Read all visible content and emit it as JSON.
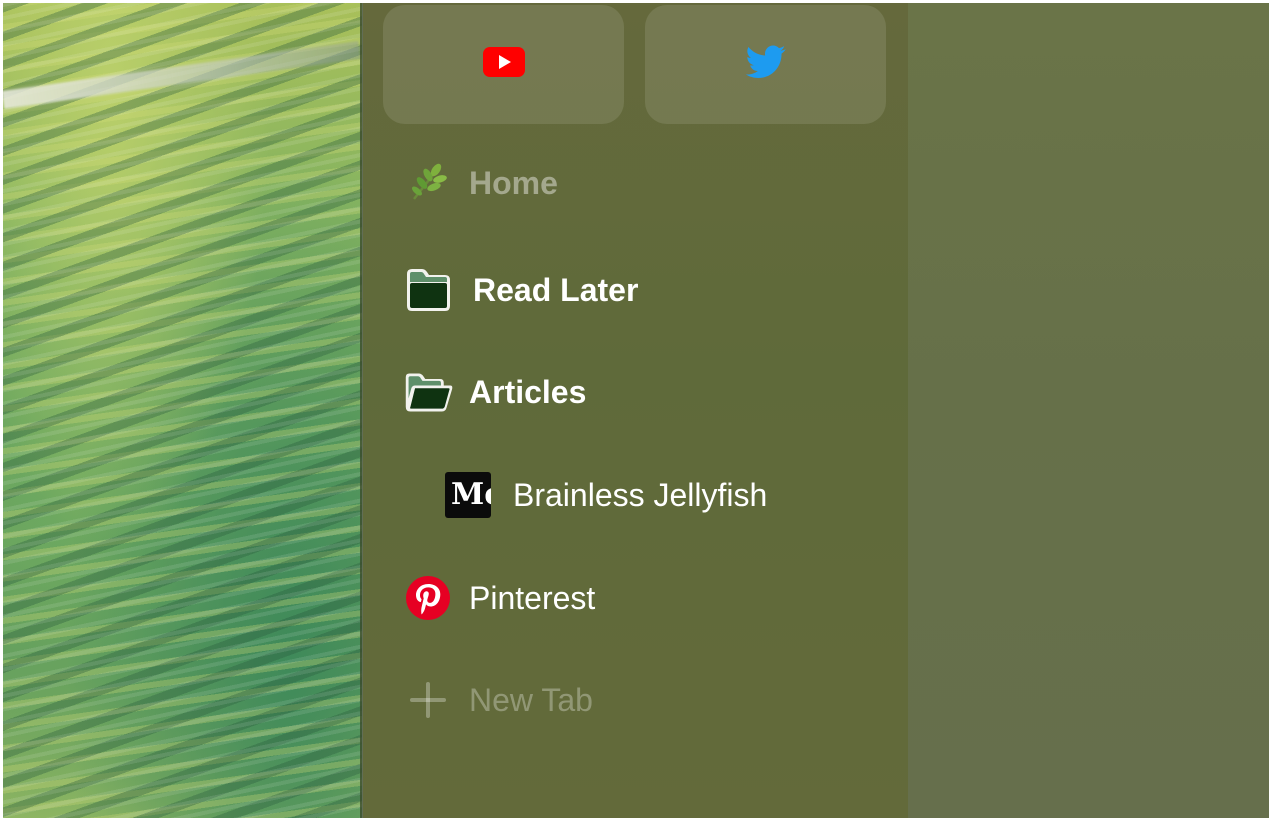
{
  "pinned": [
    {
      "name": "YouTube",
      "icon": "youtube-icon",
      "color": "#ff0000"
    },
    {
      "name": "Twitter",
      "icon": "twitter-icon",
      "color": "#1d9bf0"
    }
  ],
  "sidebar": {
    "items": [
      {
        "label": "Home",
        "icon": "leaf-icon",
        "state": "dimmed"
      },
      {
        "label": "Read Later",
        "icon": "folder-closed-icon"
      },
      {
        "label": "Articles",
        "icon": "folder-open-icon",
        "expanded": true
      },
      {
        "label": "Brainless Jellyfish",
        "icon": "medium-icon",
        "icon_text": "Me",
        "nested": true
      },
      {
        "label": "Pinterest",
        "icon": "pinterest-icon",
        "color": "#e60023"
      },
      {
        "label": "New Tab",
        "icon": "plus-icon",
        "state": "dimmed"
      }
    ]
  },
  "colors": {
    "sidebar": "#636a3a",
    "content": "#677049",
    "folder_fill": "#0f3311",
    "folder_tab": "#5e8f6a"
  }
}
